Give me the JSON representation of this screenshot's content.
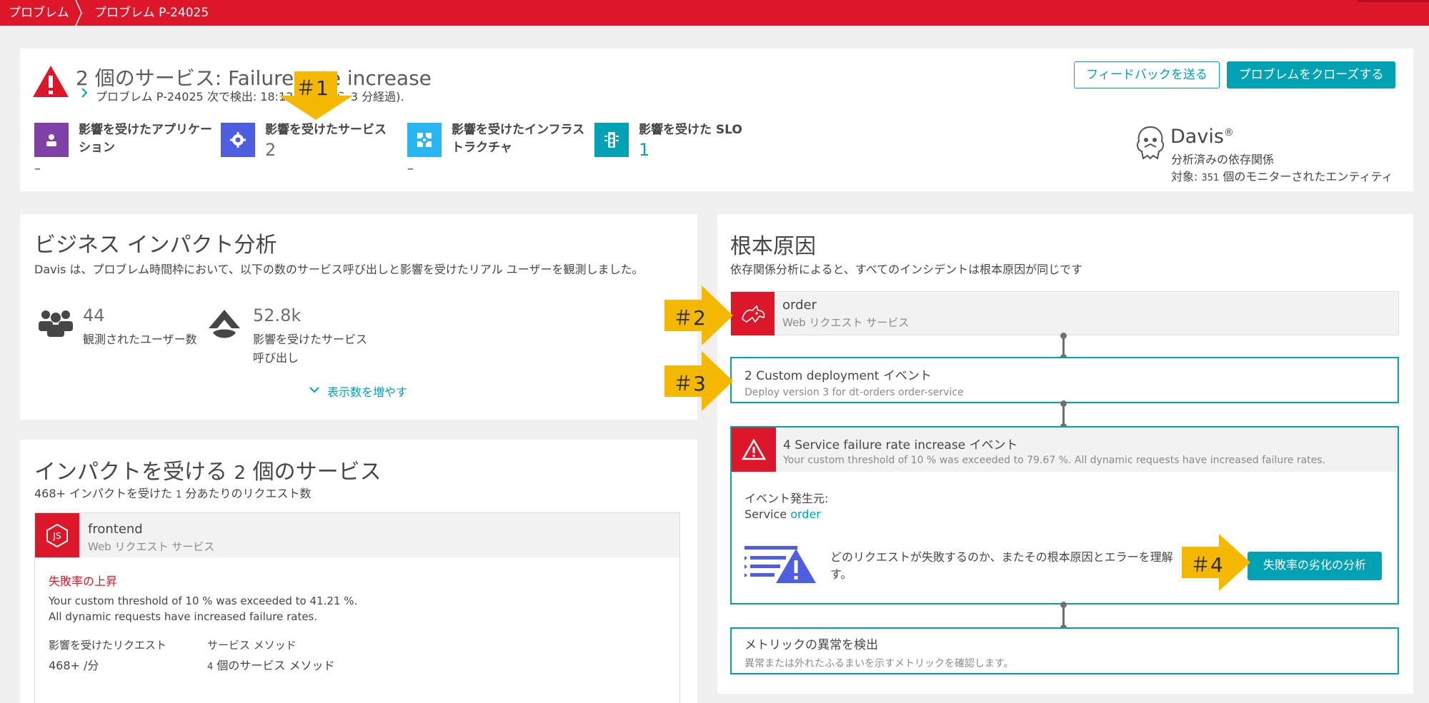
{
  "breadcrumb": {
    "root": "プロブレム",
    "current": "プロブレム P-24025"
  },
  "header": {
    "title_count": "2",
    "title_rest": "個のサービス: Failure rate increase",
    "subline": "プロブレム P-24025 次で検出: 18:13 (現在から 3 分経過).",
    "feedback_button": "フィードバックを送る",
    "close_button": "プロブレムをクローズする",
    "stats": [
      {
        "label": "影響を受けたアプリケーション",
        "value": "–",
        "icon": "application-icon",
        "color": "#7e3fa6"
      },
      {
        "label": "影響を受けたサービス",
        "value": "2",
        "icon": "gear-icon",
        "color": "#4f5ee0"
      },
      {
        "label": "影響を受けたインフラストラクチャ",
        "value": "–",
        "icon": "infrastructure-icon",
        "color": "#2ab6f4"
      },
      {
        "label": "影響を受けた SLO",
        "value": "1",
        "icon": "slo-icon",
        "color": "#00a1b2"
      }
    ],
    "davis": {
      "name": "Davis",
      "reg": "®",
      "line1": "分析済みの依存関係",
      "line2_prefix": "対象: ",
      "line2_count": "351",
      "line2_suffix": " 個のモニターされたエンティティ"
    }
  },
  "business": {
    "title": "ビジネス インパクト分析",
    "desc": "Davis は、プロブレム時間枠において、以下の数のサービス呼び出しと影響を受けたリアル ユーザーを観測しました。",
    "users_value": "44",
    "users_label": "観測されたユーザー数",
    "calls_value": "52.8k",
    "calls_label_1": "影響を受けたサービス",
    "calls_label_2": "呼び出し",
    "show_more": "表示数を増やす"
  },
  "impacted": {
    "title_prefix": "インパクトを受ける ",
    "title_count": "2",
    "title_suffix": " 個のサービス",
    "desc_prefix": "468+ インパクトを受けた ",
    "desc_count": "1",
    "desc_suffix": " 分あたりのリクエスト数",
    "service_name": "frontend",
    "service_type": "Web リクエスト サービス",
    "failure_title": "失敗率の上昇",
    "failure_line1": "Your custom threshold of 10 % was exceeded to 41.21 %.",
    "failure_line2": "All dynamic requests have increased failure rates.",
    "col1_label": "影響を受けたリクエスト",
    "col1_value": "468+ /分",
    "col2_label": "サービス メソッド",
    "col2_count": "4",
    "col2_value": " 個のサービス メソッド"
  },
  "root_cause": {
    "title": "根本原因",
    "desc": "依存関係分析によると、すべてのインシデントは根本原因が同じです",
    "service_name": "order",
    "service_type": "Web リクエスト サービス",
    "deploy_title": "2 Custom deployment イベント",
    "deploy_desc": "Deploy version 3 for dt-orders order-service",
    "failure_event_title": "4 Service failure rate increase イベント",
    "failure_event_desc": "Your custom threshold of 10 % was exceeded to 79.67 %. All dynamic requests have increased failure rates.",
    "origin_label": "イベント発生元:",
    "origin_prefix": "Service ",
    "origin_link": "order",
    "analysis_text_1": "どのリクエストが失敗するのか、またその根本原因とエラーを理解",
    "analysis_text_2": "す。",
    "analysis_button": "失敗率の劣化の分析",
    "metric_title": "メトリックの異常を検出",
    "metric_desc": "異常または外れたふるまいを示すメトリックを確認します。"
  },
  "callouts": [
    "＃1",
    "＃2",
    "＃3",
    "＃4"
  ],
  "colors": {
    "brand_red": "#dc172a",
    "teal": "#00a1b2",
    "callout_yellow": "#f5b800"
  }
}
